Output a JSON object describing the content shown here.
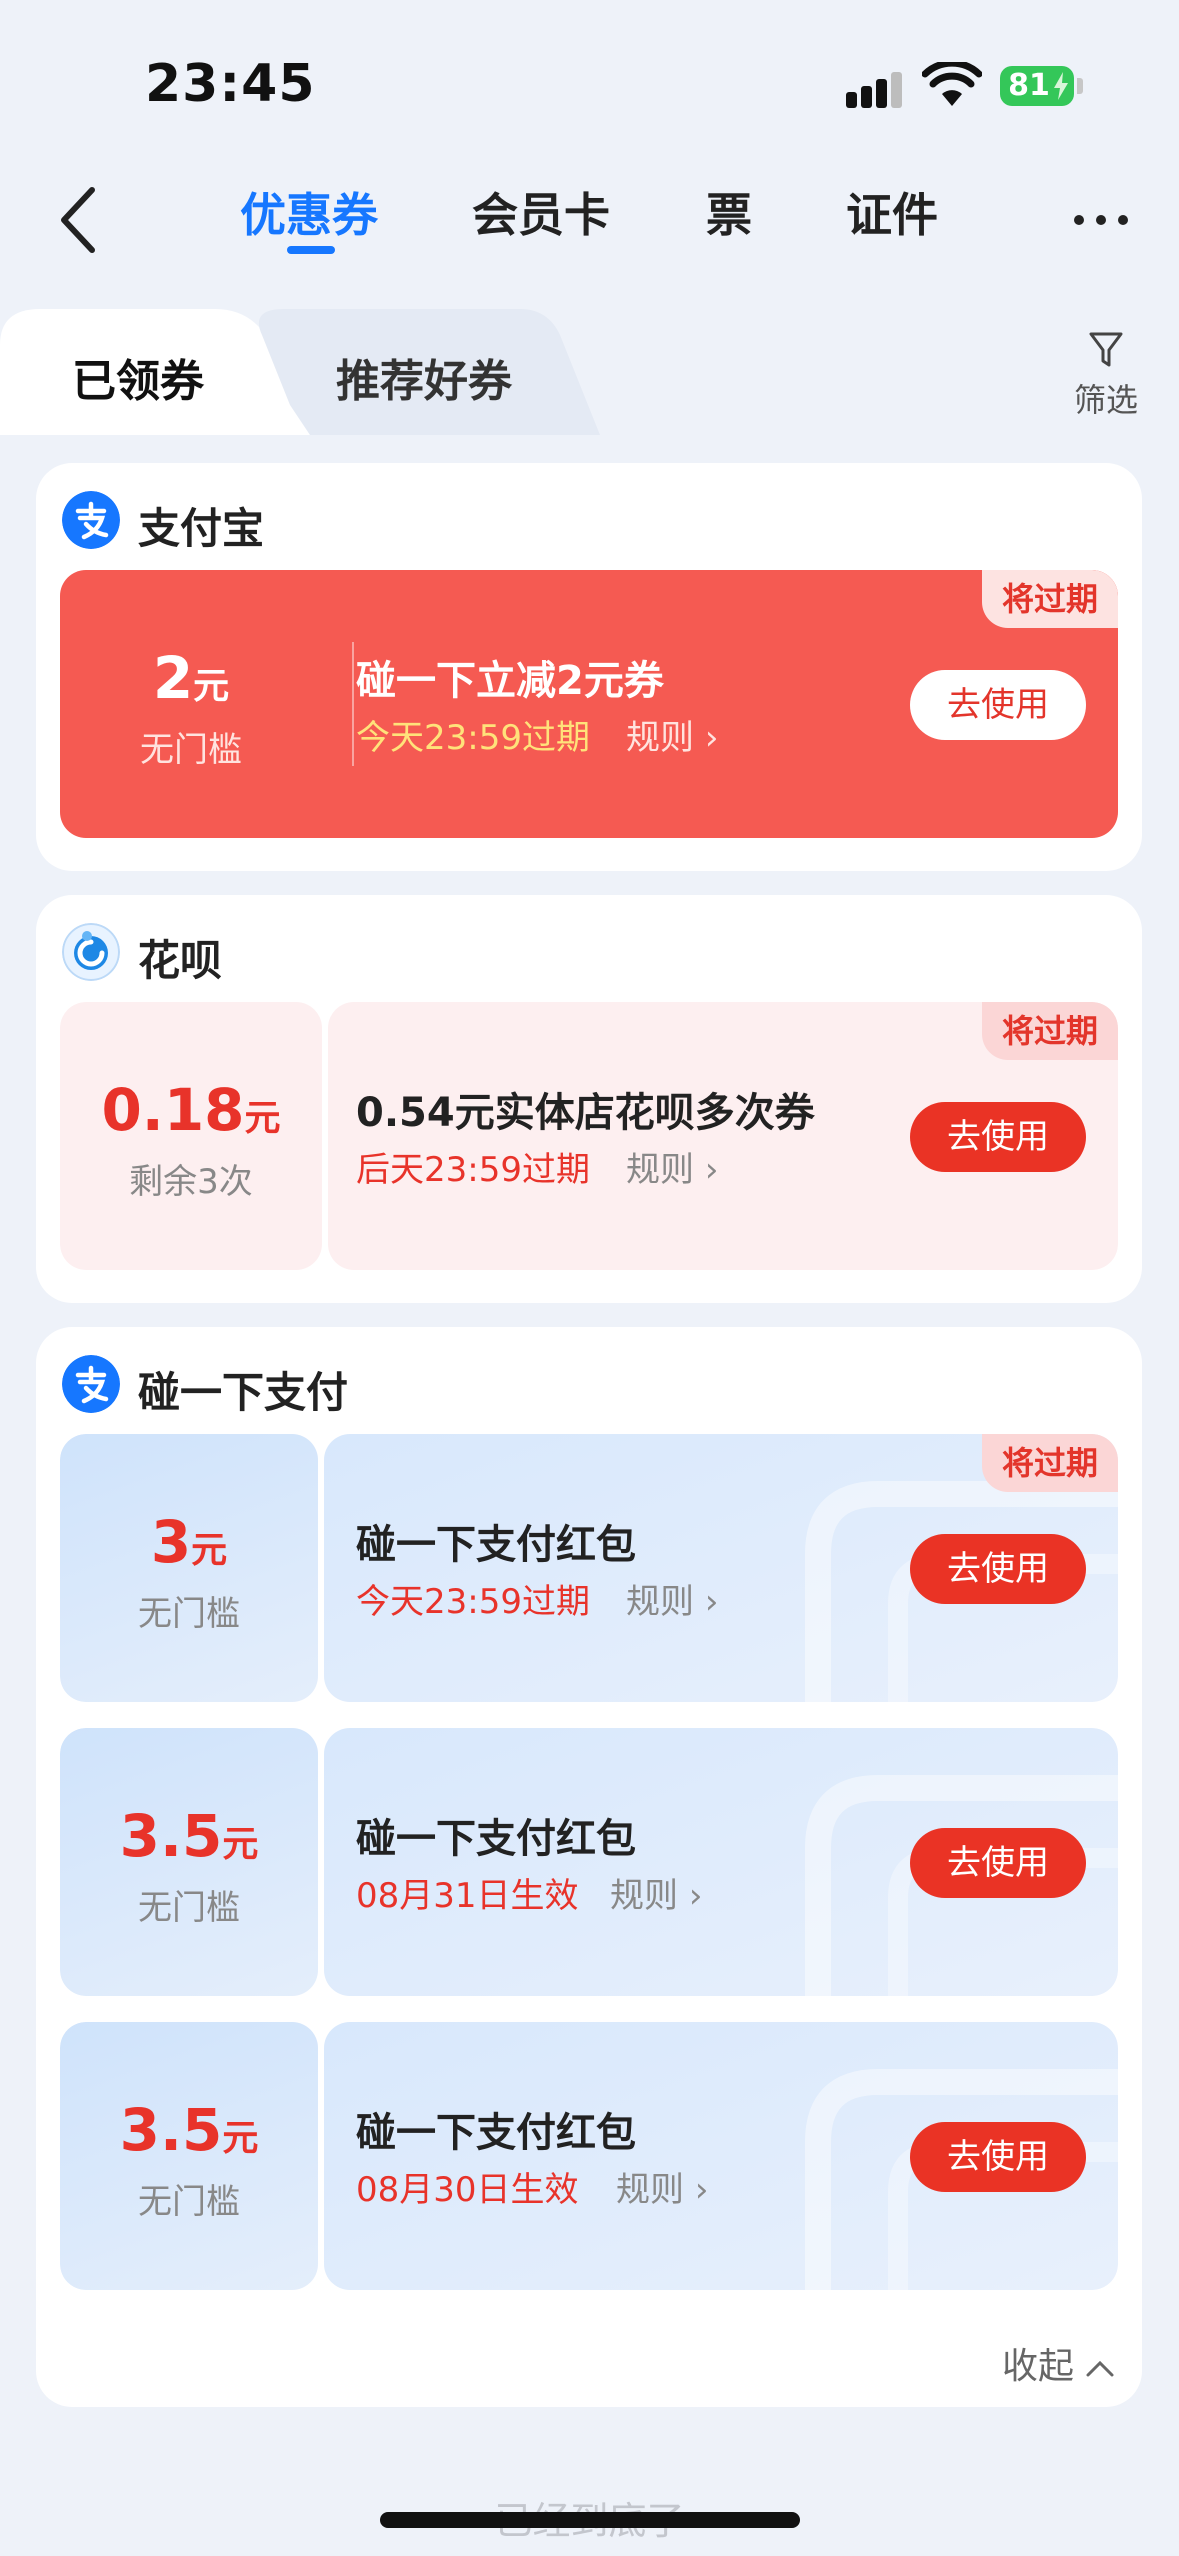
{
  "status": {
    "time": "23:45",
    "battery": "81"
  },
  "nav": {
    "tabs": [
      {
        "label": "优惠券"
      },
      {
        "label": "会员卡"
      },
      {
        "label": "票"
      },
      {
        "label": "证件"
      }
    ]
  },
  "subtabs": {
    "received": "已领券",
    "recommended": "推荐好券",
    "filter": "筛选"
  },
  "colors": {
    "accent": "#1677ff",
    "red": "#ea3325",
    "coupon_red_bg": "#f55a52",
    "badge_bg": "#fbd6d6"
  },
  "sections": [
    {
      "title": "支付宝",
      "logo": "alipay-logo",
      "coupons": [
        {
          "amount": "2",
          "unit": "元",
          "cond": "无门槛",
          "title": "碰一下立减2元券",
          "expire": "今天23:59过期",
          "rule": "规则",
          "button": "去使用",
          "badge": "将过期"
        }
      ]
    },
    {
      "title": "花呗",
      "logo": "huabei-logo",
      "coupons": [
        {
          "amount": "0.18",
          "unit": "元",
          "cond": "剩余3次",
          "title": "0.54元实体店花呗多次券",
          "expire": "后天23:59过期",
          "rule": "规则",
          "button": "去使用",
          "badge": "将过期"
        }
      ]
    },
    {
      "title": "碰一下支付",
      "logo": "alipay-logo",
      "coupons": [
        {
          "amount": "3",
          "unit": "元",
          "cond": "无门槛",
          "title": "碰一下支付红包",
          "expire": "今天23:59过期",
          "rule": "规则",
          "button": "去使用",
          "badge": "将过期"
        },
        {
          "amount": "3.5",
          "unit": "元",
          "cond": "无门槛",
          "title": "碰一下支付红包",
          "expire": "08月31日生效",
          "rule": "规则",
          "button": "去使用"
        },
        {
          "amount": "3.5",
          "unit": "元",
          "cond": "无门槛",
          "title": "碰一下支付红包",
          "expire": "08月30日生效",
          "rule": "规则",
          "button": "去使用"
        }
      ],
      "collapse": "收起"
    }
  ],
  "footer": {
    "end_text": "已经到底了"
  }
}
